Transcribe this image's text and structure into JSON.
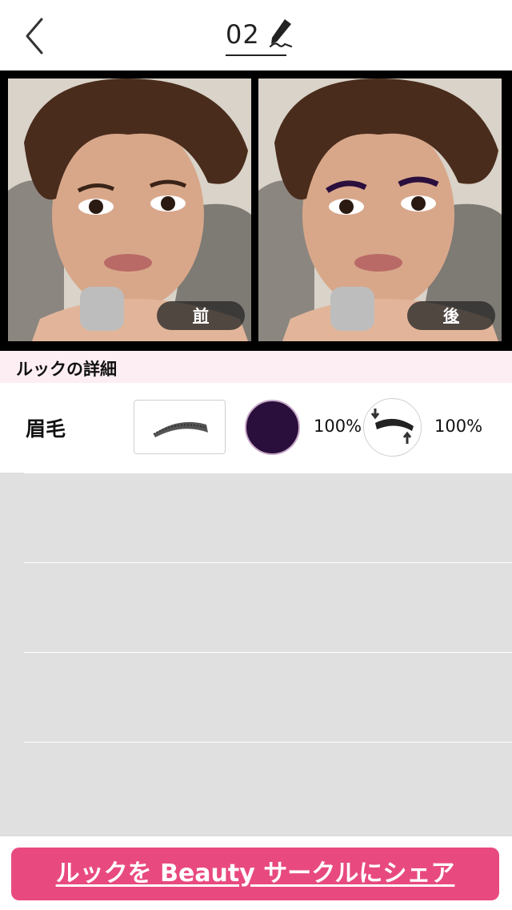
{
  "header": {
    "title": "02",
    "back_icon": "chevron-left-icon",
    "edit_icon": "pencil-icon"
  },
  "photos": {
    "before_label": "前",
    "after_label": "後"
  },
  "section": {
    "title": "ルックの詳細"
  },
  "detail": {
    "label": "眉毛",
    "brow_icon": "eyebrow-shape-icon",
    "color": "#2a0f3d",
    "opacity_value": "100%",
    "shape_icon": "eyebrow-adjust-icon",
    "shape_value": "100%"
  },
  "share": {
    "label": "ルックを Beauty サークルにシェア"
  },
  "colors": {
    "accent": "#e84a7f",
    "section_bg": "#fdeef3",
    "list_bg": "#e0e0e0"
  }
}
